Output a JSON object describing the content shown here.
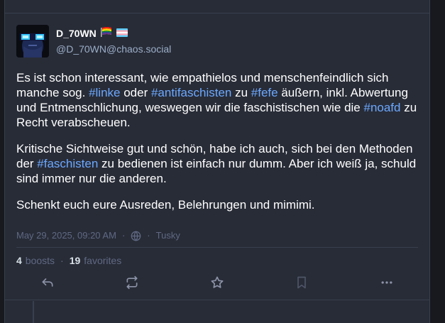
{
  "status": {
    "display_name": "D_70WN",
    "emojis": [
      "rainbow-flag-icon",
      "trans-flag-icon"
    ],
    "acct": "@D_70WN@chaos.social",
    "paragraphs": [
      [
        {
          "text": "Es ist schon interessant, wie empathielos und menschenfeindlich sich manche sog. "
        },
        {
          "text": "#linke",
          "hashtag": true
        },
        {
          "text": " oder "
        },
        {
          "text": "#antifaschisten",
          "hashtag": true
        },
        {
          "text": " zu "
        },
        {
          "text": "#fefe",
          "hashtag": true
        },
        {
          "text": " äußern, inkl. Abwertung und Entmenschlichung, weswegen wir die faschistischen wie die "
        },
        {
          "text": "#noafd",
          "hashtag": true
        },
        {
          "text": " zu Recht verabscheuen."
        }
      ],
      [
        {
          "text": "Kritische Sichtweise gut und schön, habe ich auch, sich bei den Methoden der "
        },
        {
          "text": "#faschisten",
          "hashtag": true
        },
        {
          "text": " zu bedienen ist einfach nur dumm. Aber ich weiß ja, schuld sind immer nur die anderen."
        }
      ],
      [
        {
          "text": "Schenkt euch eure Ausreden, Belehrungen und mimimi."
        }
      ]
    ],
    "timestamp": "May 29, 2025, 09:20 AM",
    "separator": "·",
    "visibility_icon": "globe-icon",
    "application": "Tusky",
    "boosts_count": "4",
    "boosts_label": "boosts",
    "favorites_count": "19",
    "favorites_label": "favorites"
  },
  "actions": [
    {
      "name": "reply-button",
      "icon": "reply-icon"
    },
    {
      "name": "boost-button",
      "icon": "boost-icon"
    },
    {
      "name": "favorite-button",
      "icon": "star-icon"
    },
    {
      "name": "bookmark-button",
      "icon": "bookmark-icon"
    },
    {
      "name": "more-button",
      "icon": "more-icon"
    }
  ],
  "colors": {
    "background": "#282c37",
    "hashtag": "#6ca8ff",
    "secondary_text": "#606984",
    "acct_text": "#9baec8"
  }
}
